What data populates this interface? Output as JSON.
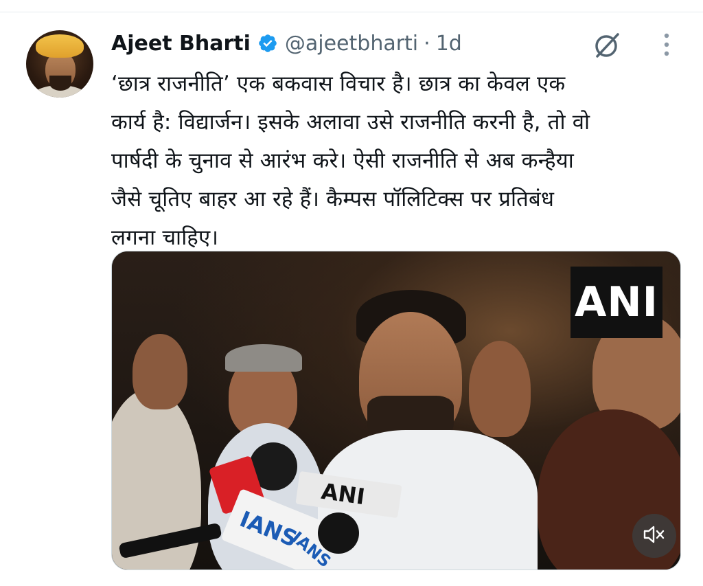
{
  "tweet": {
    "author": {
      "display_name": "Ajeet Bharti",
      "handle": "@ajeetbharti",
      "verified": true
    },
    "separator": "·",
    "time": "1d",
    "text_lines": [
      "‘छात्र राजनीति’ एक बकवास विचार है। छात्र का केवल एक",
      "कार्य है: विद्यार्जन। इसके अलावा उसे राजनीति करनी है, तो वो",
      "पार्षदी के चुनाव से आरंभ करे। ऐसी राजनीति से अब कन्हैया",
      "जैसे चूतिए बाहर आ रहे हैं। कैम्पस पॉलिटिक्स पर प्रतिबंध",
      "लगना चाहिए।"
    ],
    "media": {
      "type": "video",
      "watermark": "ANI",
      "mic_labels": [
        "ANI",
        "IANS",
        "IANS"
      ],
      "muted": true
    }
  },
  "icons": {
    "verified": "verified-badge-icon",
    "grok": "grok-icon",
    "more": "more-vertical-icon",
    "mute": "volume-muted-icon"
  },
  "colors": {
    "text_primary": "#0f1419",
    "text_secondary": "#536471",
    "verified_blue": "#1d9bf0"
  }
}
